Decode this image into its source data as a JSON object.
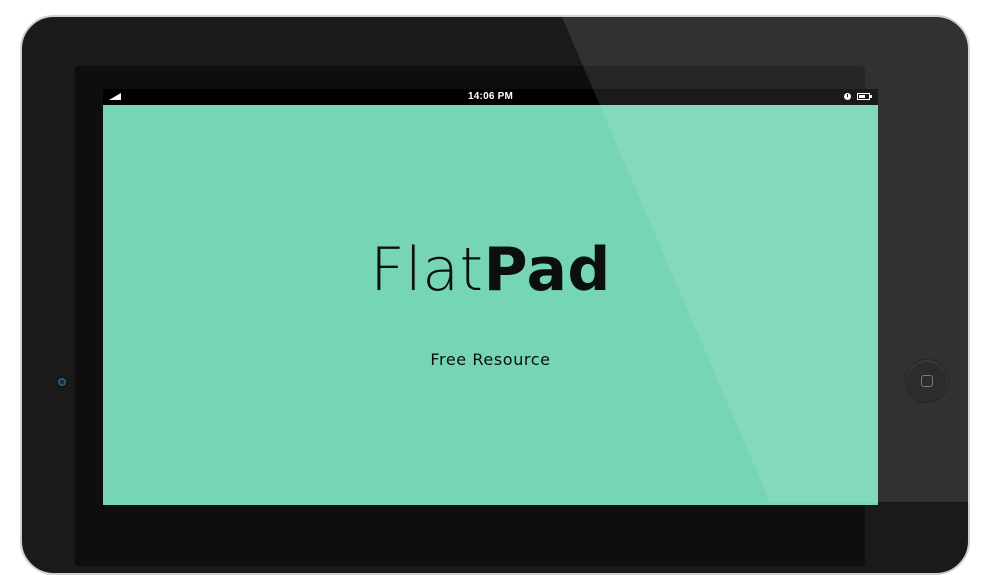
{
  "status_bar": {
    "time": "14:06 PM",
    "signal_icon": "signal-icon",
    "clock_icon": "clock-icon",
    "battery_icon": "battery-icon"
  },
  "app": {
    "title_light": "Flat",
    "title_bold": "Pad",
    "subtitle": "Free Resource"
  },
  "colors": {
    "screen_background": "#76d5b4",
    "device_body": "#1a1a1a",
    "text": "#0b0f0d"
  }
}
